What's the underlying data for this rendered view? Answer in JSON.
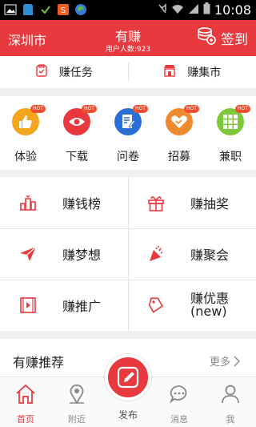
{
  "status_bar": {
    "time": "10:08",
    "icons": [
      "image-icon",
      "sd-card-icon",
      "check-icon",
      "app-s-icon",
      "globe-icon",
      "mute-icon",
      "wifi-icon",
      "signal-icon",
      "battery-icon"
    ]
  },
  "header": {
    "city": "深圳市",
    "title": "有赚",
    "user_count": "用户人数:923",
    "login": "签到"
  },
  "top_tabs": [
    {
      "label": "赚任务",
      "icon": "clipboard-icon"
    },
    {
      "label": "赚集市",
      "icon": "shop-icon"
    }
  ],
  "categories": [
    {
      "label": "体验",
      "color": "#f3a51e",
      "icon": "thumbs-up-icon",
      "badge": "HOT"
    },
    {
      "label": "下载",
      "color": "#e8393f",
      "icon": "eye-icon",
      "badge": "HOT"
    },
    {
      "label": "问卷",
      "color": "#2a6fd6",
      "icon": "survey-icon",
      "badge": "HOT"
    },
    {
      "label": "招募",
      "color": "#f08a2e",
      "icon": "handshake-icon",
      "badge": "HOT"
    },
    {
      "label": "兼职",
      "color": "#7cc83a",
      "icon": "grid-icon",
      "badge": "HOT"
    }
  ],
  "grid_menu": [
    {
      "label": "赚钱榜",
      "icon": "ranking-icon"
    },
    {
      "label": "赚抽奖",
      "icon": "gift-icon"
    },
    {
      "label": "赚梦想",
      "icon": "paper-plane-icon"
    },
    {
      "label": "赚聚会",
      "icon": "party-icon"
    },
    {
      "label": "赚推广",
      "icon": "video-icon"
    },
    {
      "label": "赚优惠\n(new)",
      "icon": "tag-icon"
    }
  ],
  "recommend": {
    "title": "有赚推荐",
    "more": "更多"
  },
  "bottom_nav": [
    {
      "label": "首页",
      "icon": "home-icon"
    },
    {
      "label": "附近",
      "icon": "location-icon"
    },
    {
      "label": "发布",
      "icon": "edit-icon"
    },
    {
      "label": "消息",
      "icon": "message-icon"
    },
    {
      "label": "我",
      "icon": "user-icon"
    }
  ],
  "colors": {
    "brand": "#e8393f"
  }
}
